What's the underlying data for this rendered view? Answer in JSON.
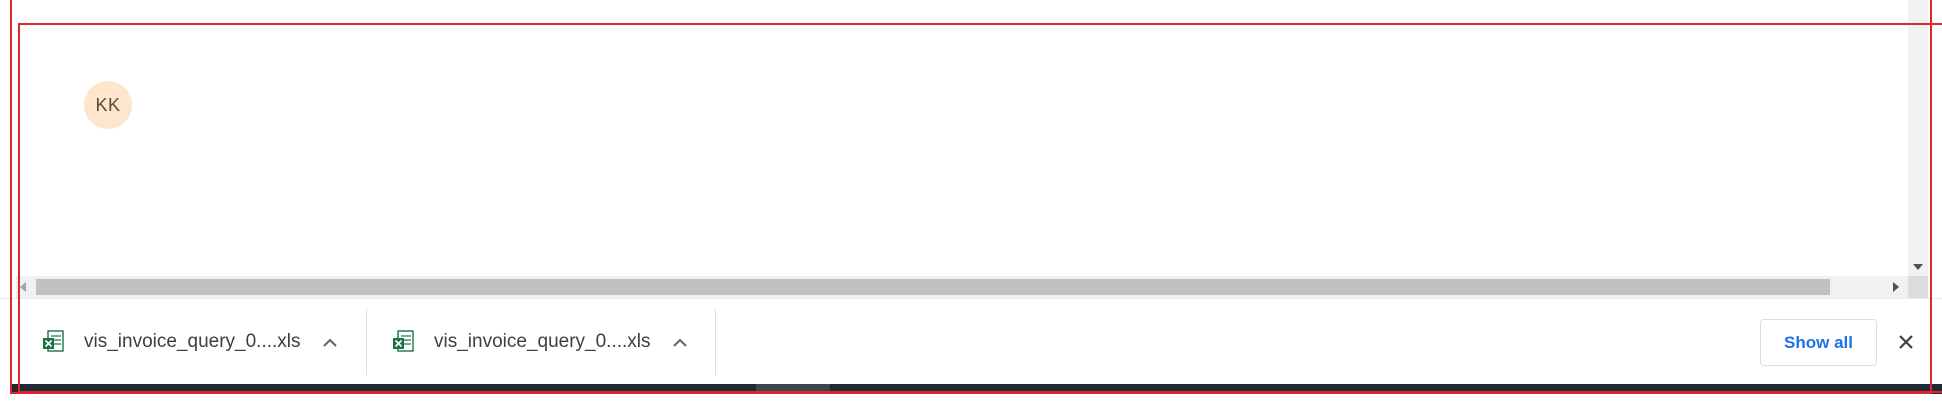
{
  "avatar": {
    "initials": "KK"
  },
  "downloads": [
    {
      "filename": "vis_invoice_query_0....xls",
      "icon": "excel-file-icon"
    },
    {
      "filename": "vis_invoice_query_0....xls",
      "icon": "excel-file-icon"
    }
  ],
  "shelf": {
    "show_all_label": "Show all",
    "close_icon": "close-icon"
  },
  "colors": {
    "accent": "#1a73e8",
    "avatar_bg": "#fde6cc",
    "annotation": "#e2242c",
    "excel_green": "#1e7145"
  }
}
